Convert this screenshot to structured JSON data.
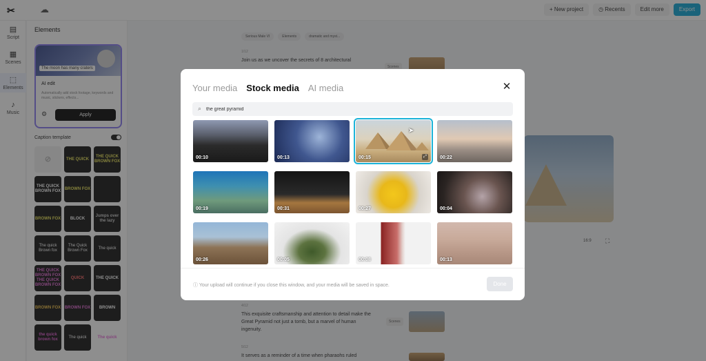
{
  "app": {
    "logo_text": "✂",
    "top_actions": [
      "+ New project",
      "◷ Recents",
      "Edit more",
      "Export"
    ]
  },
  "rail": [
    {
      "icon": "▤",
      "label": "Script"
    },
    {
      "icon": "▦",
      "label": "Scenes"
    },
    {
      "icon": "⬚",
      "label": "Elements"
    },
    {
      "icon": "♪",
      "label": "Music"
    }
  ],
  "panel": {
    "title": "Elements",
    "ai_card": {
      "caption": "The moon has many craters",
      "edit_label": "AI edit",
      "description": "Automatically add stock footage, keywords and music, stickers, effects...",
      "apply_label": "Apply"
    },
    "caption_template_label": "Caption template",
    "templates": [
      "⊘",
      "THE QUICK",
      "THE QUICK BROWN FOX",
      "THE QUICK BROWN FOX",
      "BROWN FOX",
      "",
      "BROWN FOX",
      "BLOCK",
      "Jumps over the lazy",
      "The quick Brown fox",
      "The Quick Brown Fox",
      "The quick",
      "THE QUICK BROWN FOX THE QUICK BROWN FOX",
      "QUICK",
      "THE QUICK",
      "BROWN FOX",
      "BROWN FOX",
      "BROWN",
      "the quick brown fox",
      "The quick",
      "The quick"
    ]
  },
  "main": {
    "chips": [
      "Serious Male VI",
      "Elements",
      "dramatic and myst..."
    ],
    "script_blocks": [
      {
        "num": "1/12",
        "text": "Join us as we uncover the secrets of 8 architectural"
      },
      {
        "num": "4/12",
        "text": "This exquisite craftsmanship and attention to detail make the Great Pyramid not just a tomb, but a marvel of human ingenuity."
      },
      {
        "num": "5/12",
        "text": "It serves as a reminder of a time when pharaohs ruled"
      }
    ],
    "scene_tag": "Scenes",
    "ratio_label": "16:9"
  },
  "modal": {
    "tabs": [
      "Your media",
      "Stock media",
      "AI media"
    ],
    "active_tab": 1,
    "close_icon": "✕",
    "search": {
      "value": "the great pyramid",
      "placeholder": "Search"
    },
    "thumbs": [
      {
        "duration": "00:10"
      },
      {
        "duration": "00:13"
      },
      {
        "duration": "00:15",
        "selected": true
      },
      {
        "duration": "00:22"
      },
      {
        "duration": "00:19"
      },
      {
        "duration": "00:31"
      },
      {
        "duration": "00:27"
      },
      {
        "duration": "00:04"
      },
      {
        "duration": "00:26"
      },
      {
        "duration": "00:05"
      },
      {
        "duration": "00:08"
      },
      {
        "duration": "00:13"
      }
    ],
    "info_text": "Your upload will continue if you close this window, and your media will be saved in space.",
    "done_label": "Done"
  },
  "colors": {
    "accent": "#1bb3d8",
    "export_button": "#16a9d6",
    "ai_card_border": "#8a7cf0"
  }
}
